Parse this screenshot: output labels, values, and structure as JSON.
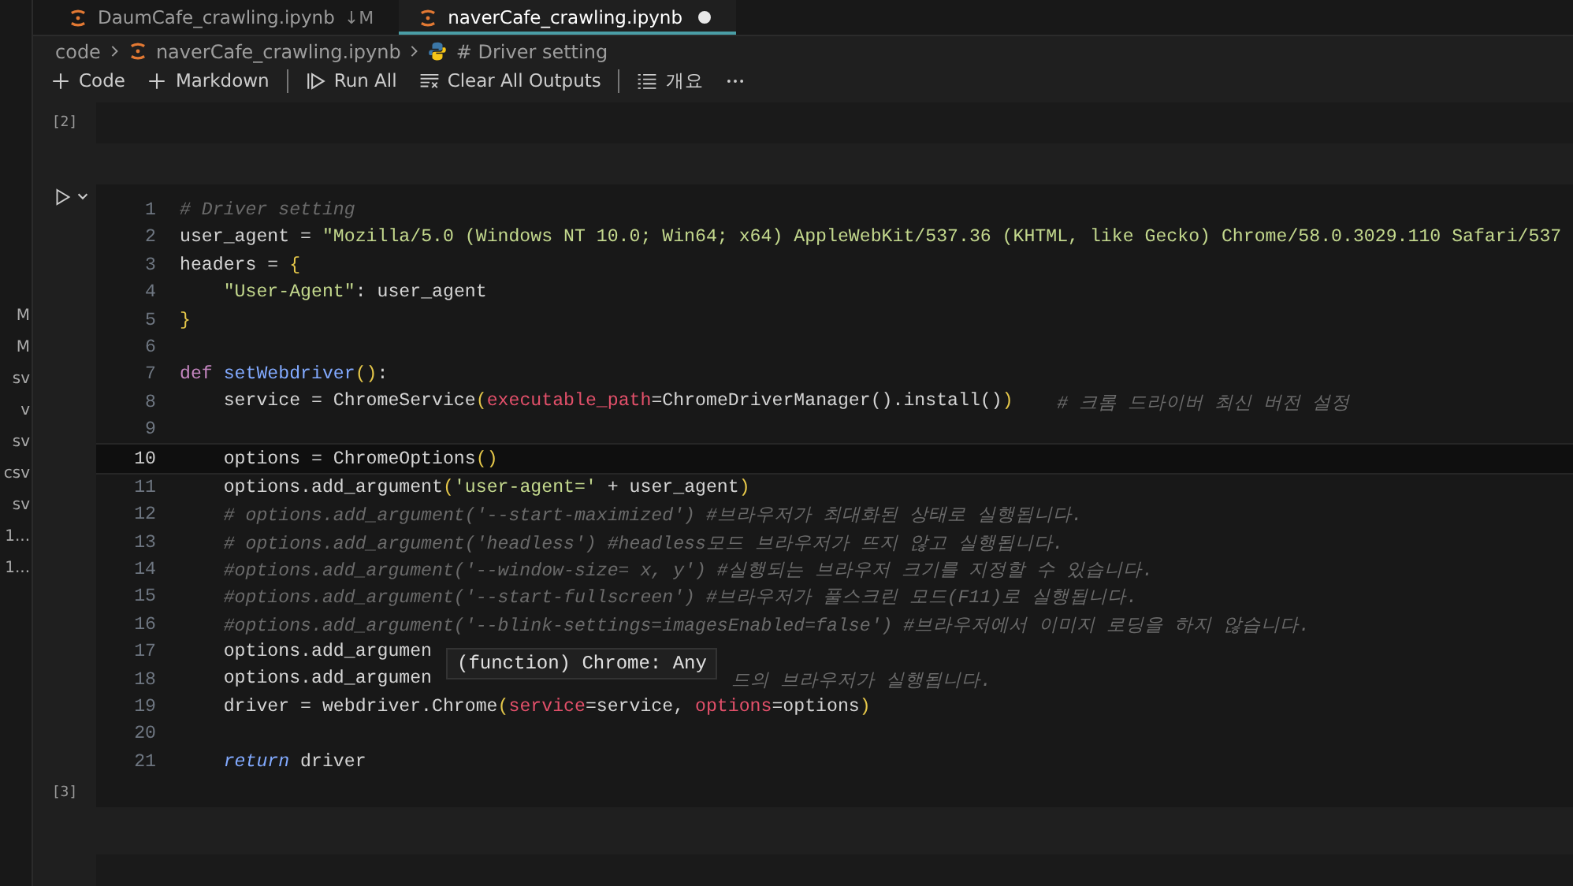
{
  "explorer_fragments": [
    "M",
    "M",
    "sv",
    "v",
    "sv",
    "csv",
    "sv",
    "1...",
    "1..."
  ],
  "tabs": [
    {
      "label": "DaumCafe_crawling.ipynb",
      "badge": "↓M",
      "selected": false,
      "dirty": false
    },
    {
      "label": "naverCafe_crawling.ipynb",
      "selected": true,
      "dirty": true
    }
  ],
  "breadcrumb": [
    {
      "kind": "folder",
      "label": "code"
    },
    {
      "kind": "notebook",
      "label": "naverCafe_crawling.ipynb"
    },
    {
      "kind": "python",
      "label": "# Driver setting"
    }
  ],
  "toolbar": [
    {
      "kind": "plus",
      "label": "Code"
    },
    {
      "kind": "plus",
      "label": "Markdown"
    },
    {
      "kind": "separator"
    },
    {
      "kind": "run",
      "label": "Run All"
    },
    {
      "kind": "clear",
      "label": "Clear All Outputs"
    },
    {
      "kind": "separator"
    },
    {
      "kind": "outline",
      "label": "개요"
    },
    {
      "kind": "more"
    }
  ],
  "previous_cell": {
    "execution_count": "[2]"
  },
  "code_cell": {
    "execution_count": "[3]",
    "lines": [
      {
        "number": "1",
        "current": false,
        "indented": false,
        "tokens": [
          {
            "kind": "comment",
            "text": "# Driver setting"
          }
        ]
      },
      {
        "number": "2",
        "current": false,
        "indented": false,
        "tokens": [
          {
            "kind": "plain",
            "text": "user_agent = "
          },
          {
            "kind": "string",
            "text": "\"Mozilla/5.0 (Windows NT 10.0; Win64; x64) AppleWebKit/537.36 (KHTML, like Gecko) Chrome/58.0.3029.110 Safari/537"
          }
        ]
      },
      {
        "number": "3",
        "current": false,
        "indented": false,
        "tokens": [
          {
            "kind": "plain",
            "text": "headers = "
          },
          {
            "kind": "bracket",
            "text": "{"
          }
        ]
      },
      {
        "number": "4",
        "current": false,
        "indented": true,
        "tokens": [
          {
            "kind": "string",
            "text": "\"User-Agent\""
          },
          {
            "kind": "plain",
            "text": ": user_agent"
          }
        ]
      },
      {
        "number": "5",
        "current": false,
        "indented": false,
        "tokens": [
          {
            "kind": "bracket",
            "text": "}"
          }
        ]
      },
      {
        "number": "6",
        "current": false
      },
      {
        "number": "7",
        "current": false,
        "indented": false,
        "tokens": [
          {
            "kind": "keyword",
            "text": "def "
          },
          {
            "kind": "function",
            "text": "setWebdriver"
          },
          {
            "kind": "bracket",
            "text": "()"
          },
          {
            "kind": "plain",
            "text": ":"
          }
        ]
      },
      {
        "number": "8",
        "current": false,
        "indented": true,
        "tokens": [
          {
            "kind": "plain",
            "text": "service = ChromeService"
          },
          {
            "kind": "bracket",
            "text": "("
          },
          {
            "kind": "param",
            "text": "executable_path"
          },
          {
            "kind": "plain",
            "text": "=ChromeDriverManager().install()"
          },
          {
            "kind": "bracket",
            "text": ")"
          },
          {
            "kind": "gap"
          },
          {
            "kind": "comment",
            "text": "# 크롬 드라이버 최신 버전 설정"
          }
        ]
      },
      {
        "number": "9",
        "current": false
      },
      {
        "number": "10",
        "current": true,
        "indented": true,
        "tokens": [
          {
            "kind": "plain",
            "text": "options = ChromeOptions"
          },
          {
            "kind": "bracket",
            "text": "()"
          }
        ]
      },
      {
        "number": "11",
        "current": false,
        "indented": true,
        "tokens": [
          {
            "kind": "plain",
            "text": "options.add_argument"
          },
          {
            "kind": "bracket",
            "text": "("
          },
          {
            "kind": "string",
            "text": "'user-agent='"
          },
          {
            "kind": "plain",
            "text": " + user_agent"
          },
          {
            "kind": "bracket",
            "text": ")"
          }
        ]
      },
      {
        "number": "12",
        "current": false,
        "indented": true,
        "tokens": [
          {
            "kind": "comment",
            "text": "# options.add_argument('--start-maximized') #브라우저가 최대화된 상태로 실행됩니다."
          }
        ]
      },
      {
        "number": "13",
        "current": false,
        "indented": true,
        "tokens": [
          {
            "kind": "comment",
            "text": "# options.add_argument('headless') #headless모드 브라우저가 뜨지 않고 실행됩니다."
          }
        ]
      },
      {
        "number": "14",
        "current": false,
        "indented": true,
        "tokens": [
          {
            "kind": "comment",
            "text": "#options.add_argument('--window-size= x, y') #실행되는 브라우저 크기를 지정할 수 있습니다."
          }
        ]
      },
      {
        "number": "15",
        "current": false,
        "indented": true,
        "tokens": [
          {
            "kind": "comment",
            "text": "#options.add_argument('--start-fullscreen') #브라우저가 풀스크린 모드(F11)로 실행됩니다."
          }
        ]
      },
      {
        "number": "16",
        "current": false,
        "indented": true,
        "tokens": [
          {
            "kind": "comment",
            "text": "#options.add_argument('--blink-settings=imagesEnabled=false') #브라우저에서 이미지 로딩을 하지 않습니다."
          }
        ]
      },
      {
        "number": "17",
        "current": false,
        "indented": true,
        "tokens": [
          {
            "kind": "plain",
            "text": "options.add_argumen"
          }
        ]
      },
      {
        "number": "18",
        "current": false,
        "indented": true,
        "tokens": [
          {
            "kind": "plain",
            "text": "options.add_argumen"
          },
          {
            "kind": "covered"
          },
          {
            "kind": "comment",
            "text": "드의 브라우저가 실행됩니다."
          }
        ]
      },
      {
        "number": "19",
        "current": false,
        "indented": true,
        "tokens": [
          {
            "kind": "plain",
            "text": "driver = webdriver.Chrome"
          },
          {
            "kind": "bracket",
            "text": "("
          },
          {
            "kind": "param",
            "text": "service"
          },
          {
            "kind": "plain",
            "text": "=service, "
          },
          {
            "kind": "param",
            "text": "options"
          },
          {
            "kind": "plain",
            "text": "=options"
          },
          {
            "kind": "bracket",
            "text": ")"
          }
        ]
      },
      {
        "number": "20",
        "current": false
      },
      {
        "number": "21",
        "current": false,
        "indented": true,
        "tokens": [
          {
            "kind": "control",
            "text": "return"
          },
          {
            "kind": "plain",
            "text": " driver"
          }
        ]
      }
    ]
  },
  "hover_tooltip": {
    "text": "(function) Chrome: Any"
  }
}
